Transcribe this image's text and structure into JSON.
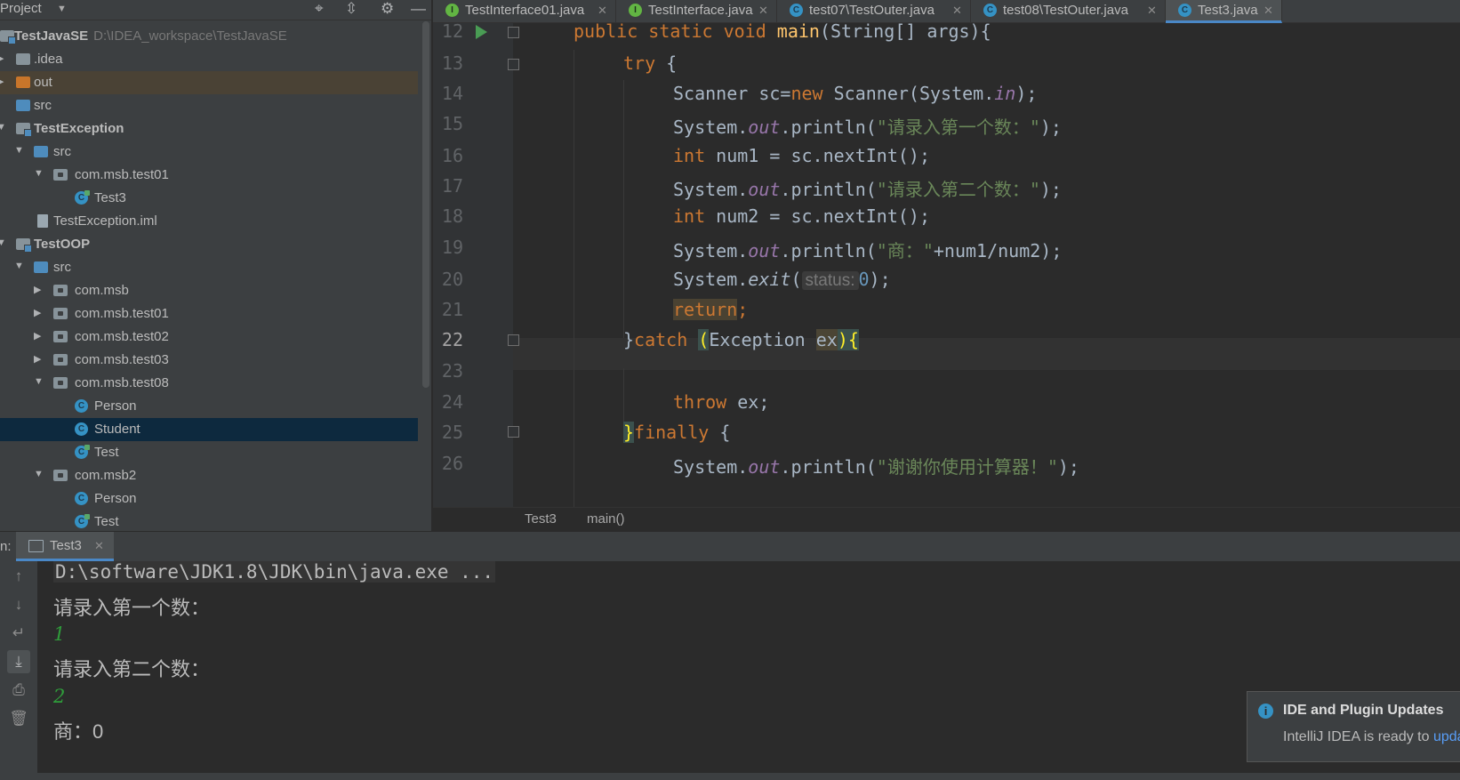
{
  "project_panel": {
    "title": "Project",
    "header_icons": [
      "crosshair-icon",
      "collapse-all-icon",
      "gear-icon",
      "minimize-icon"
    ],
    "tree": [
      {
        "label": "TestJavaSE",
        "path": "D:\\IDEA_workspace\\TestJavaSE",
        "bold": true
      },
      {
        "label": ".idea"
      },
      {
        "label": "out"
      },
      {
        "label": "src"
      },
      {
        "label": "TestException",
        "bold": true
      },
      {
        "label": "src"
      },
      {
        "label": "com.msb.test01"
      },
      {
        "label": "Test3"
      },
      {
        "label": "TestException.iml"
      },
      {
        "label": "TestOOP",
        "bold": true
      },
      {
        "label": "src"
      },
      {
        "label": "com.msb"
      },
      {
        "label": "com.msb.test01"
      },
      {
        "label": "com.msb.test02"
      },
      {
        "label": "com.msb.test03"
      },
      {
        "label": "com.msb.test08"
      },
      {
        "label": "Person"
      },
      {
        "label": "Student"
      },
      {
        "label": "Test"
      },
      {
        "label": "com.msb2"
      },
      {
        "label": "Person"
      },
      {
        "label": "Test"
      }
    ]
  },
  "tabs": [
    {
      "label": "TestInterface01.java",
      "icon": "interface-icon"
    },
    {
      "label": "TestInterface.java",
      "icon": "interface-icon"
    },
    {
      "label": "test07\\TestOuter.java",
      "icon": "class-icon"
    },
    {
      "label": "test08\\TestOuter.java",
      "icon": "class-icon"
    },
    {
      "label": "Test3.java",
      "icon": "class-icon",
      "active": true
    }
  ],
  "editor": {
    "line_numbers": [
      "12",
      "13",
      "14",
      "15",
      "16",
      "17",
      "18",
      "19",
      "20",
      "21",
      "22",
      "23",
      "24",
      "25",
      "26"
    ],
    "current_line": "22",
    "code": {
      "l12": {
        "kw": "public static void ",
        "fn": "main",
        "rest": "(String[] args){"
      },
      "l13": {
        "kw": "try",
        "rest": " {"
      },
      "l14": {
        "a": "Scanner sc=",
        "kw": "new",
        "b": " Scanner(System.",
        "fld": "in",
        "c": ");"
      },
      "l15": {
        "a": "System.",
        "fld": "out",
        "b": ".println(",
        "str": "\"请录入第一个数：\"",
        "c": ");"
      },
      "l16": {
        "kw": "int",
        "rest": " num1 = sc.nextInt();"
      },
      "l17": {
        "a": "System.",
        "fld": "out",
        "b": ".println(",
        "str": "\"请录入第二个数：\"",
        "c": ");"
      },
      "l18": {
        "kw": "int",
        "rest": " num2 = sc.nextInt();"
      },
      "l19": {
        "a": "System.",
        "fld": "out",
        "b": ".println(",
        "str": "\"商：\"",
        "c": "+num1/num2);"
      },
      "l20": {
        "a": "System.",
        "itl": "exit",
        "b": "(",
        "hint": "status:",
        "num": "0",
        "c": ");"
      },
      "l21": {
        "kw": "return",
        "c": ";"
      },
      "l22": {
        "a": "}",
        "kw": "catch ",
        "p1": "(",
        "b": "Exception ",
        "var": "ex",
        "p2": "){"
      },
      "l24": {
        "kw": "throw",
        "rest": " ex;"
      },
      "l25": {
        "a": "}",
        "kw": "finally",
        "rest": " {"
      },
      "l26": {
        "a": "System.",
        "fld": "out",
        "b": ".println(",
        "str": "\"谢谢你使用计算器！\"",
        "c": ");"
      }
    }
  },
  "breadcrumb": {
    "items": [
      "Test3",
      "main()"
    ],
    "separator": "›"
  },
  "run": {
    "label": "n:",
    "tab_label": "Test3",
    "toolbar_icons": [
      "up-arrow-icon",
      "down-arrow-icon",
      "soft-wrap-icon",
      "scroll-to-end-icon",
      "print-icon",
      "trash-icon"
    ],
    "console": [
      {
        "text": "D:\\software\\JDK1.8\\JDK\\bin\\java.exe ...",
        "type": "cmd"
      },
      {
        "text": "请录入第一个数：",
        "type": "out"
      },
      {
        "text": "1",
        "type": "input"
      },
      {
        "text": "请录入第二个数：",
        "type": "out"
      },
      {
        "text": "2",
        "type": "input"
      },
      {
        "text": "商：0",
        "type": "out"
      }
    ]
  },
  "notification": {
    "title": "IDE and Plugin Updates",
    "body": "IntelliJ IDEA is ready to ",
    "link": "upda"
  },
  "colors": {
    "accent": "#4a88c7",
    "keyword": "#cc7832",
    "string": "#6a8759",
    "function": "#ffc66d",
    "field": "#9876aa",
    "background": "#2b2b2b"
  }
}
